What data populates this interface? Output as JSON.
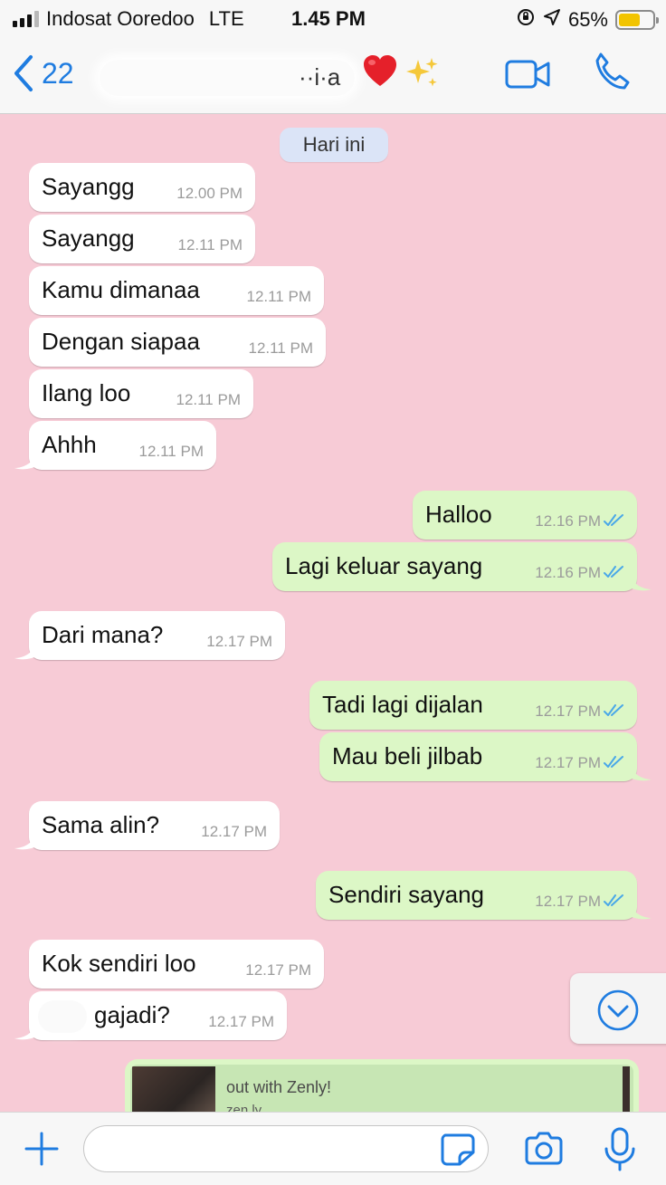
{
  "status_bar": {
    "carrier": "Indosat Ooredoo",
    "network": "LTE",
    "time": "1.45 PM",
    "battery_percent": "65%",
    "battery_level": 0.65,
    "icons": [
      "signal-icon",
      "rotation-lock-icon",
      "location-icon",
      "battery-icon"
    ]
  },
  "header": {
    "back_count": "22",
    "contact_name_fragment": "··i·a",
    "icons": [
      "back-chevron-icon",
      "red-heart-icon",
      "sparkles-icon",
      "video-call-icon",
      "phone-call-icon"
    ]
  },
  "date_chip": "Hari ini",
  "messages": [
    {
      "dir": "in",
      "text": "Sayangg",
      "time": "12.00 PM"
    },
    {
      "dir": "in",
      "text": "Sayangg",
      "time": "12.11 PM"
    },
    {
      "dir": "in",
      "text": "Kamu dimanaa",
      "time": "12.11 PM"
    },
    {
      "dir": "in",
      "text": "Dengan siapaa",
      "time": "12.11 PM"
    },
    {
      "dir": "in",
      "text": "Ilang loo",
      "time": "12.11 PM"
    },
    {
      "dir": "in",
      "text": "Ahhh",
      "time": "12.11 PM"
    },
    {
      "dir": "out",
      "text": "Halloo",
      "time": "12.16 PM",
      "status": "read"
    },
    {
      "dir": "out",
      "text": "Lagi keluar sayang",
      "time": "12.16 PM",
      "status": "read"
    },
    {
      "dir": "in",
      "text": "Dari mana?",
      "time": "12.17 PM"
    },
    {
      "dir": "out",
      "text": "Tadi lagi dijalan",
      "time": "12.17 PM",
      "status": "read"
    },
    {
      "dir": "out",
      "text": "Mau beli jilbab",
      "time": "12.17 PM",
      "status": "read"
    },
    {
      "dir": "in",
      "text": "Sama alin?",
      "time": "12.17 PM"
    },
    {
      "dir": "out",
      "text": "Sendiri sayang",
      "time": "12.17 PM",
      "status": "read"
    },
    {
      "dir": "in",
      "text": "Kok sendiri loo",
      "time": "12.17 PM"
    },
    {
      "dir": "in",
      "text": "gajadi?",
      "time": "12.17 PM"
    }
  ],
  "link_preview": {
    "description": "out with Zenly!",
    "domain": "zen.ly"
  },
  "colors": {
    "chat_background": "#f7cbd6",
    "incoming_bubble": "#ffffff",
    "outgoing_bubble": "#dcf7c6",
    "accent_blue": "#1f7ce0",
    "read_tick": "#4aa8e8",
    "date_chip": "#dbe4f7"
  },
  "input_bar": {
    "placeholder": "",
    "icons": [
      "plus-icon",
      "sticker-icon",
      "camera-icon",
      "microphone-icon"
    ]
  },
  "scroll_button": {
    "icon": "chevron-down-circle-icon"
  }
}
